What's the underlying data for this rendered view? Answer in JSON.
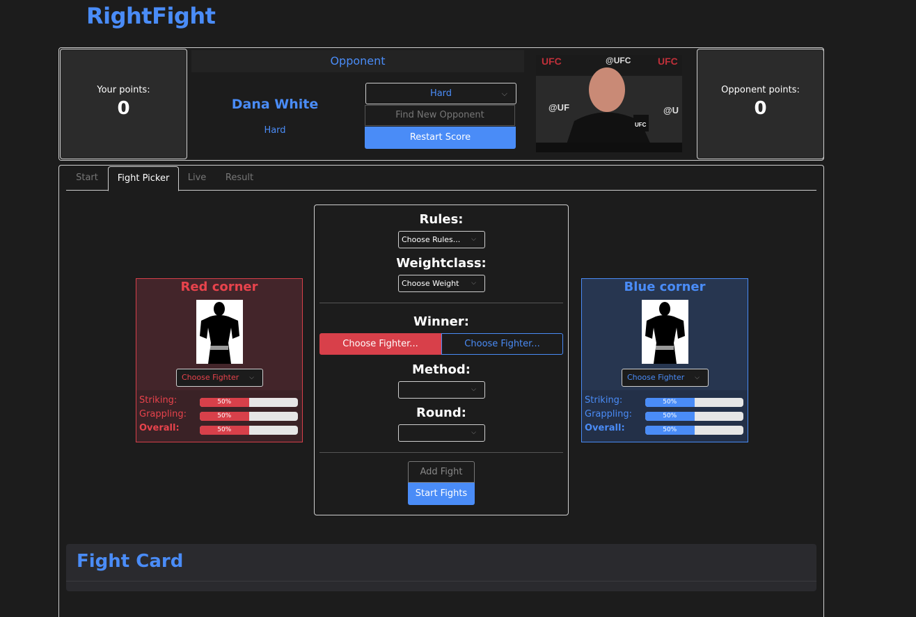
{
  "app": {
    "title": "RightFight"
  },
  "score": {
    "your_label": "Your points:",
    "your_value": "0",
    "opponent_label": "Opponent points:",
    "opponent_value": "0"
  },
  "opponent": {
    "header": "Opponent",
    "name": "Dana White",
    "difficulty": "Hard",
    "difficulty_select_value": "Hard",
    "find_button": "Find New Opponent",
    "restart_button": "Restart Score"
  },
  "tabs": [
    {
      "label": "Start",
      "active": false
    },
    {
      "label": "Fight Picker",
      "active": true
    },
    {
      "label": "Live",
      "active": false
    },
    {
      "label": "Result",
      "active": false
    }
  ],
  "red_corner": {
    "title": "Red corner",
    "select_value": "Choose Fighter",
    "stats": [
      {
        "label": "Striking:",
        "value": "50%",
        "fraction": 0.5
      },
      {
        "label": "Grappling:",
        "value": "50%",
        "fraction": 0.5
      },
      {
        "label": "Overall:",
        "value": "50%",
        "fraction": 0.5
      }
    ]
  },
  "blue_corner": {
    "title": "Blue corner",
    "select_value": "Choose Fighter",
    "stats": [
      {
        "label": "Striking:",
        "value": "50%",
        "fraction": 0.5
      },
      {
        "label": "Grappling:",
        "value": "50%",
        "fraction": 0.5
      },
      {
        "label": "Overall:",
        "value": "50%",
        "fraction": 0.5
      }
    ]
  },
  "picker": {
    "rules_label": "Rules:",
    "rules_value": "Choose Rules...",
    "weightclass_label": "Weightclass:",
    "weightclass_value": "Choose Weight",
    "winner_label": "Winner:",
    "winner_red": "Choose Fighter...",
    "winner_blue": "Choose Fighter...",
    "method_label": "Method:",
    "method_value": "",
    "round_label": "Round:",
    "round_value": "",
    "add_fight": "Add Fight",
    "start_fights": "Start Fights"
  },
  "fight_card": {
    "title": "Fight Card"
  },
  "colors": {
    "accent": "#4a8cf7",
    "red": "#d8404a",
    "background": "#1c1c1c"
  },
  "icons": {
    "dropdown": "chevron-down-icon"
  }
}
